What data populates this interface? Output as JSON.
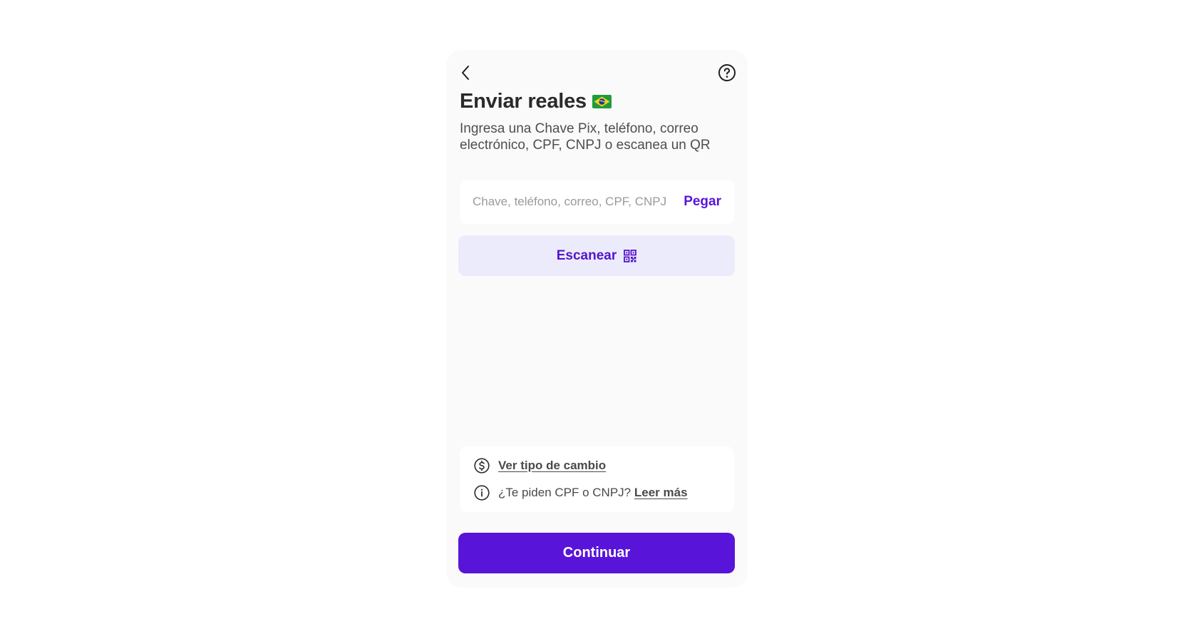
{
  "header": {
    "back_icon": "chevron-left-icon",
    "help_icon": "question-circle-icon"
  },
  "title": "Enviar reales",
  "title_flag": "brazil-flag-icon",
  "subtitle": "Ingresa una Chave Pix, teléfono, correo electrónico, CPF, CNPJ o escanea un QR",
  "key_input": {
    "placeholder": "Chave, teléfono, correo, CPF, CNPJ",
    "value": "",
    "paste_label": "Pegar"
  },
  "scan": {
    "label": "Escanear",
    "icon": "qr-code-icon"
  },
  "info": {
    "exchange_link": "Ver tipo de cambio",
    "exchange_icon": "dollar-circle-icon",
    "cpf_question": "¿Te piden CPF o CNPJ?",
    "read_more_link": "Leer más",
    "info_icon": "info-circle-icon"
  },
  "continue_label": "Continuar",
  "colors": {
    "primary": "#5914d9",
    "scan_bg": "#ecebfc",
    "screen_bg": "#fafafa",
    "text_dark": "#2a2a2a"
  }
}
